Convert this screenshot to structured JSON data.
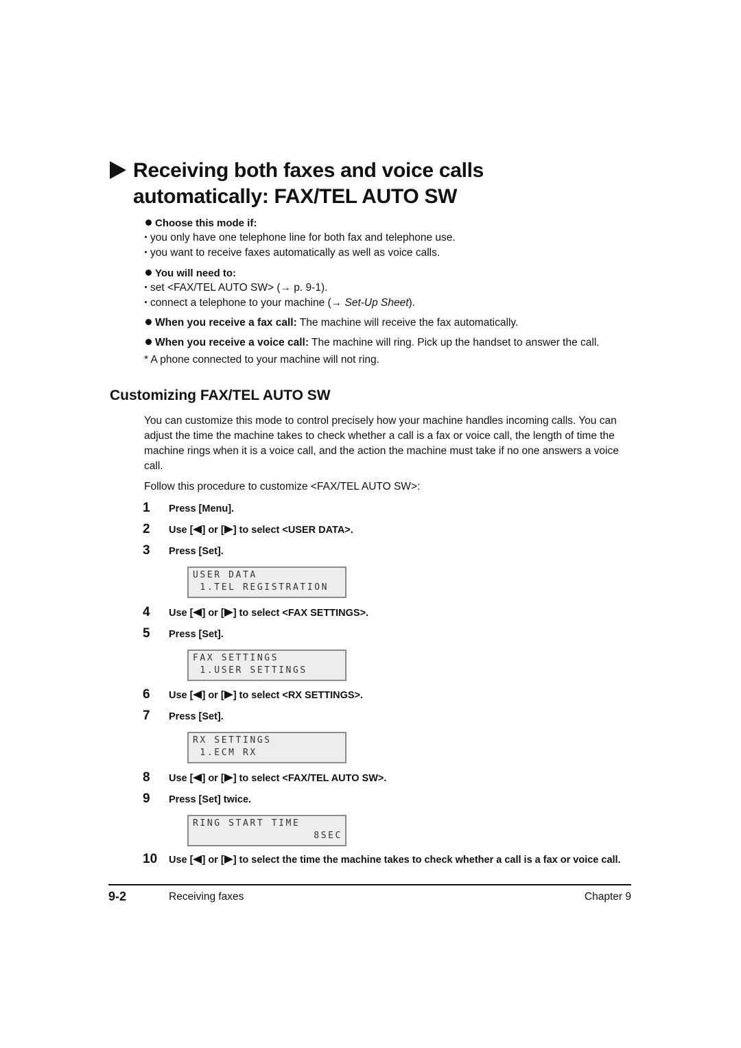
{
  "title": {
    "line1": "Receiving both faxes and voice calls",
    "line2": "automatically: FAX/TEL AUTO SW"
  },
  "choose": {
    "heading": "Choose this mode if:",
    "items": [
      "you only have one telephone line for both fax and telephone use.",
      "you want to receive faxes automatically as well as voice calls."
    ]
  },
  "need": {
    "heading": "You will need to:",
    "item1": "set <FAX/TEL AUTO SW> (→ p. 9-1).",
    "item2_prefix": "connect a telephone to your machine (→ ",
    "item2_italic": "Set-Up Sheet",
    "item2_suffix": ")."
  },
  "fax_call": {
    "label": "When you receive a fax call:",
    "text": " The machine will receive the fax automatically."
  },
  "voice_call": {
    "label": "When you receive a voice call:",
    "text": " The machine will ring. Pick up the handset to answer the call."
  },
  "note": "* A phone connected to your machine will not ring.",
  "section": {
    "heading": "Customizing FAX/TEL AUTO SW",
    "intro": "You can customize this mode to control precisely how your machine handles incoming calls. You can adjust the time the machine takes to check whether a call is a fax or voice call, the length of time the machine rings when it is a voice call, and the action the machine must take if no one answers a voice call.",
    "follow": "Follow this procedure to customize <FAX/TEL AUTO SW>:"
  },
  "steps": [
    {
      "num": "1",
      "text": "Press [Menu]."
    },
    {
      "num": "2",
      "pre": "Use [",
      "mid": "] or [",
      "post": "] to select <USER DATA>."
    },
    {
      "num": "3",
      "text": "Press [Set]."
    },
    {
      "num": "4",
      "pre": "Use [",
      "mid": "] or [",
      "post": "] to select <FAX SETTINGS>."
    },
    {
      "num": "5",
      "text": "Press [Set]."
    },
    {
      "num": "6",
      "pre": "Use [",
      "mid": "] or [",
      "post": "] to select <RX SETTINGS>."
    },
    {
      "num": "7",
      "text": "Press [Set]."
    },
    {
      "num": "8",
      "pre": "Use [",
      "mid": "] or [",
      "post": "] to select <FAX/TEL AUTO SW>."
    },
    {
      "num": "9",
      "text": "Press [Set] twice."
    },
    {
      "num": "10",
      "pre": "Use [",
      "mid": "] or [",
      "post": "] to select the time the machine takes to check whether a call is a fax or voice call."
    }
  ],
  "lcd": [
    {
      "line1": "USER DATA",
      "line2": " 1.TEL REGISTRATION"
    },
    {
      "line1": "FAX SETTINGS",
      "line2": " 1.USER SETTINGS"
    },
    {
      "line1": "RX SETTINGS",
      "line2": " 1.ECM RX"
    },
    {
      "line1": "RING START TIME",
      "line2": "8SEC"
    }
  ],
  "footer": {
    "page": "9-2",
    "section": "Receiving faxes",
    "chapter": "Chapter 9"
  }
}
